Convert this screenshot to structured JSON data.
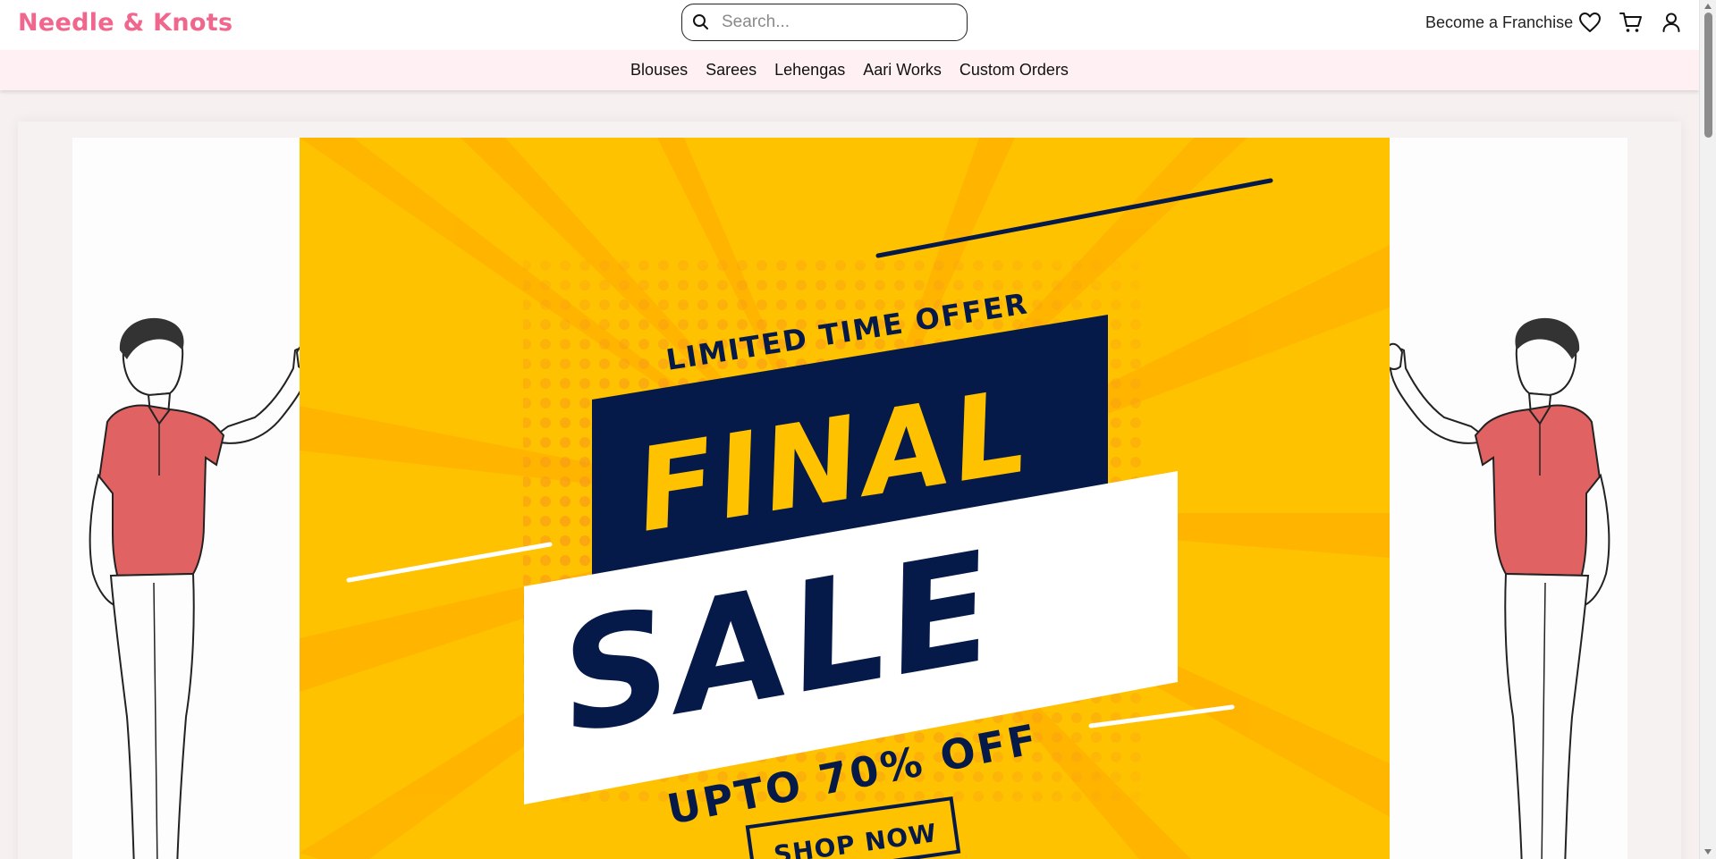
{
  "brand": {
    "name": "Needle & Knots",
    "color": "#f0668c"
  },
  "search": {
    "placeholder": "Search..."
  },
  "header": {
    "franchise_label": "Become a Franchise",
    "icons": [
      "heart-icon",
      "cart-icon",
      "user-icon"
    ]
  },
  "nav": {
    "items": [
      {
        "label": "Blouses"
      },
      {
        "label": "Sarees"
      },
      {
        "label": "Lehengas"
      },
      {
        "label": "Aari Works"
      },
      {
        "label": "Custom Orders"
      }
    ]
  },
  "banner": {
    "kicker": "LIMITED TIME OFFER",
    "title_top": "FINAL",
    "title_bottom": "SALE",
    "discount": "UPTO 70% OFF",
    "cta": "SHOP NOW",
    "colors": {
      "background": "#ffc200",
      "navy": "#061a4a",
      "accent": "#f7941d",
      "shirt": "#e06262"
    }
  }
}
